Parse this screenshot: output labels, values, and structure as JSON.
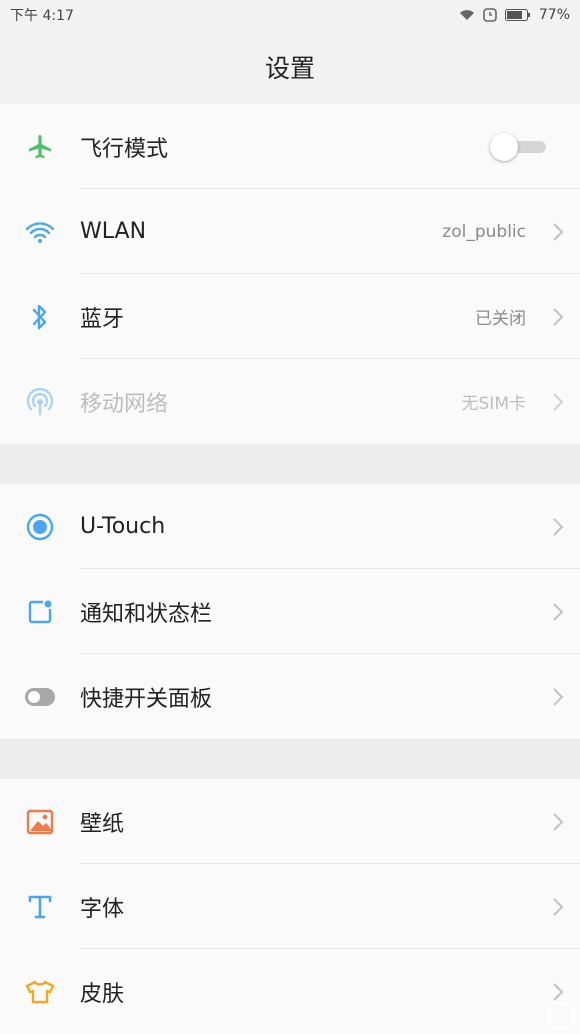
{
  "status": {
    "time": "下午 4:17",
    "battery": "77%"
  },
  "header": {
    "title": "设置"
  },
  "group1": [
    {
      "label": "飞行模式",
      "icon": "airplane-icon"
    },
    {
      "label": "WLAN",
      "value": "zol_public",
      "icon": "wifi-icon"
    },
    {
      "label": "蓝牙",
      "value": "已关闭",
      "icon": "bluetooth-icon"
    },
    {
      "label": "移动网络",
      "value": "无SIM卡",
      "icon": "mobile-network-icon"
    }
  ],
  "group2": [
    {
      "label": "U-Touch",
      "icon": "utouch-icon"
    },
    {
      "label": "通知和状态栏",
      "icon": "notification-icon"
    },
    {
      "label": "快捷开关面板",
      "icon": "toggle-panel-icon"
    }
  ],
  "group3": [
    {
      "label": "壁纸",
      "icon": "wallpaper-icon"
    },
    {
      "label": "字体",
      "icon": "font-icon"
    },
    {
      "label": "皮肤",
      "icon": "skin-icon"
    }
  ],
  "airplane_mode_on": false,
  "colors": {
    "accent": "#4aa6f0",
    "green": "#4cc06a",
    "orange": "#f07a4a"
  }
}
